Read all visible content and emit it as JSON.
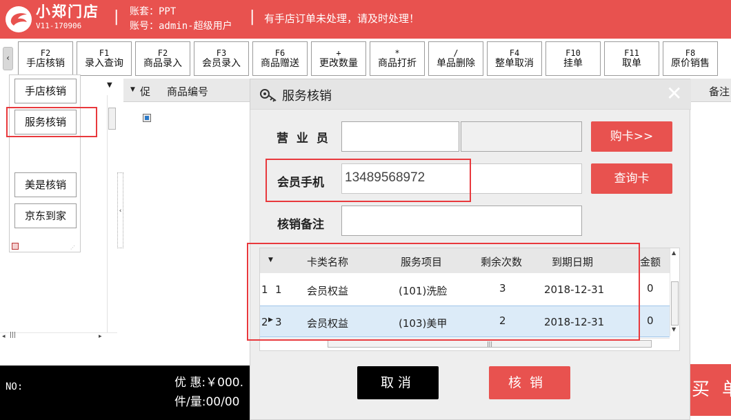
{
  "header": {
    "store_name": "小郑门店",
    "version": "V11-170906",
    "account_set": "账套：PPT",
    "account": "账号：admin-超级用户",
    "notice": "有手店订单未处理，请及时处理！"
  },
  "toolbar": {
    "scroll_left": "‹",
    "buttons": [
      {
        "key": "F2",
        "label": "手店核销"
      },
      {
        "key": "F1",
        "label": "录入查询"
      },
      {
        "key": "F2",
        "label": "商品录入"
      },
      {
        "key": "F3",
        "label": "会员录入"
      },
      {
        "key": "F6",
        "label": "商品赠送"
      },
      {
        "key": "+",
        "label": "更改数量"
      },
      {
        "key": "*",
        "label": "商品打折"
      },
      {
        "key": "/",
        "label": "单品删除"
      },
      {
        "key": "F4",
        "label": "整单取消"
      },
      {
        "key": "F10",
        "label": "挂单"
      },
      {
        "key": "F11",
        "label": "取单"
      },
      {
        "key": "F8",
        "label": "原价销售"
      }
    ]
  },
  "side_menu": {
    "items": [
      "手店核销",
      "服务核销",
      "美是核销",
      "京东到家"
    ]
  },
  "main_grid": {
    "col_promo": "促",
    "col_code": "商品编号",
    "col_note": "备注"
  },
  "bottom": {
    "no_label": "NO:",
    "discount": "优 惠:￥000.",
    "qty": "件/量:00/00",
    "buy": "买单"
  },
  "dialog": {
    "title": "服务核销",
    "close": "✕",
    "salesperson_label": "营 业 员",
    "salesperson_value": "",
    "salesperson_name": "",
    "buy_card_button": "购卡>>",
    "member_phone_label": "会员手机",
    "member_phone_value": "13489568972",
    "query_card_button": "查询卡",
    "note_label": "核销备注",
    "note_value": "",
    "card_table": {
      "columns": [
        "卡类名称",
        "服务项目",
        "剩余次数",
        "到期日期",
        "金额"
      ],
      "rows": [
        {
          "index": "1",
          "no": "1",
          "card_type": "会员权益",
          "service": "(101)洗脸",
          "remaining": "3",
          "expiry": "2018-12-31",
          "amount": "0"
        },
        {
          "index": "2",
          "no": "3",
          "card_type": "会员权益",
          "service": "(103)美甲",
          "remaining": "2",
          "expiry": "2018-12-31",
          "amount": "0"
        }
      ]
    },
    "cancel_button": "取消",
    "confirm_button": "核销"
  },
  "colors": {
    "brand_red": "#e8524f",
    "highlight_red": "#e8383c",
    "selected_row": "#dcebf8"
  }
}
